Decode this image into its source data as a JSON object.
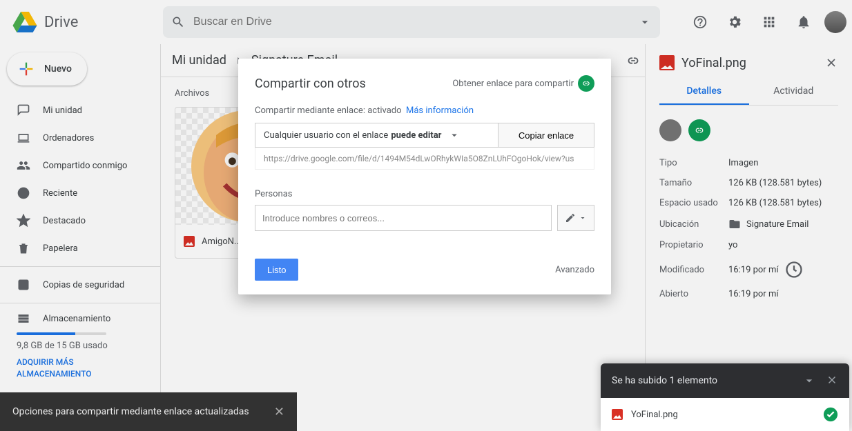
{
  "header": {
    "product_name": "Drive",
    "search_placeholder": "Buscar en Drive"
  },
  "sidebar": {
    "new_label": "Nuevo",
    "items": [
      {
        "label": "Mi unidad"
      },
      {
        "label": "Ordenadores"
      },
      {
        "label": "Compartido conmigo"
      },
      {
        "label": "Reciente"
      },
      {
        "label": "Destacado"
      },
      {
        "label": "Papelera"
      }
    ],
    "backups_label": "Copias de seguridad",
    "storage_label": "Almacenamiento",
    "storage_used": "9,8 GB de 15 GB usado",
    "storage_upgrade": "ADQUIRIR MÁS ALMACENAMIENTO"
  },
  "breadcrumb": {
    "root": "Mi unidad",
    "folder": "Signature Email"
  },
  "files": {
    "heading": "Archivos",
    "card_name": "AmigoN..."
  },
  "share_dialog": {
    "title": "Compartir con otros",
    "get_link": "Obtener enlace para compartir",
    "link_status_prefix": "Compartir mediante enlace: activado",
    "more_info": "Más información",
    "permission_prefix": "Cualquier usuario con el enlace ",
    "permission_bold": "puede editar",
    "copy_label": "Copiar enlace",
    "url": "https://drive.google.com/file/d/1494M54dLwORhykWIa5O8ZnLUhFOgoHok/view?us",
    "people_label": "Personas",
    "people_placeholder": "Introduce nombres o correos...",
    "done_label": "Listo",
    "advanced_label": "Avanzado"
  },
  "detail": {
    "filename": "YoFinal.png",
    "tabs": {
      "details": "Detalles",
      "activity": "Actividad"
    },
    "rows": {
      "type_label": "Tipo",
      "type_value": "Imagen",
      "size_label": "Tamaño",
      "size_value": "126 KB (128.581 bytes)",
      "used_label": "Espacio usado",
      "used_value": "126 KB (128.581 bytes)",
      "loc_label": "Ubicación",
      "loc_value": "Signature Email",
      "owner_label": "Propietario",
      "owner_value": "yo",
      "mod_label": "Modificado",
      "mod_value": "16:19 por mí",
      "open_label": "Abierto",
      "open_value": "16:19 por mí"
    }
  },
  "toast": {
    "message": "Opciones para compartir mediante enlace actualizadas"
  },
  "upload": {
    "header": "Se ha subido 1 elemento",
    "file": "YoFinal.png"
  }
}
